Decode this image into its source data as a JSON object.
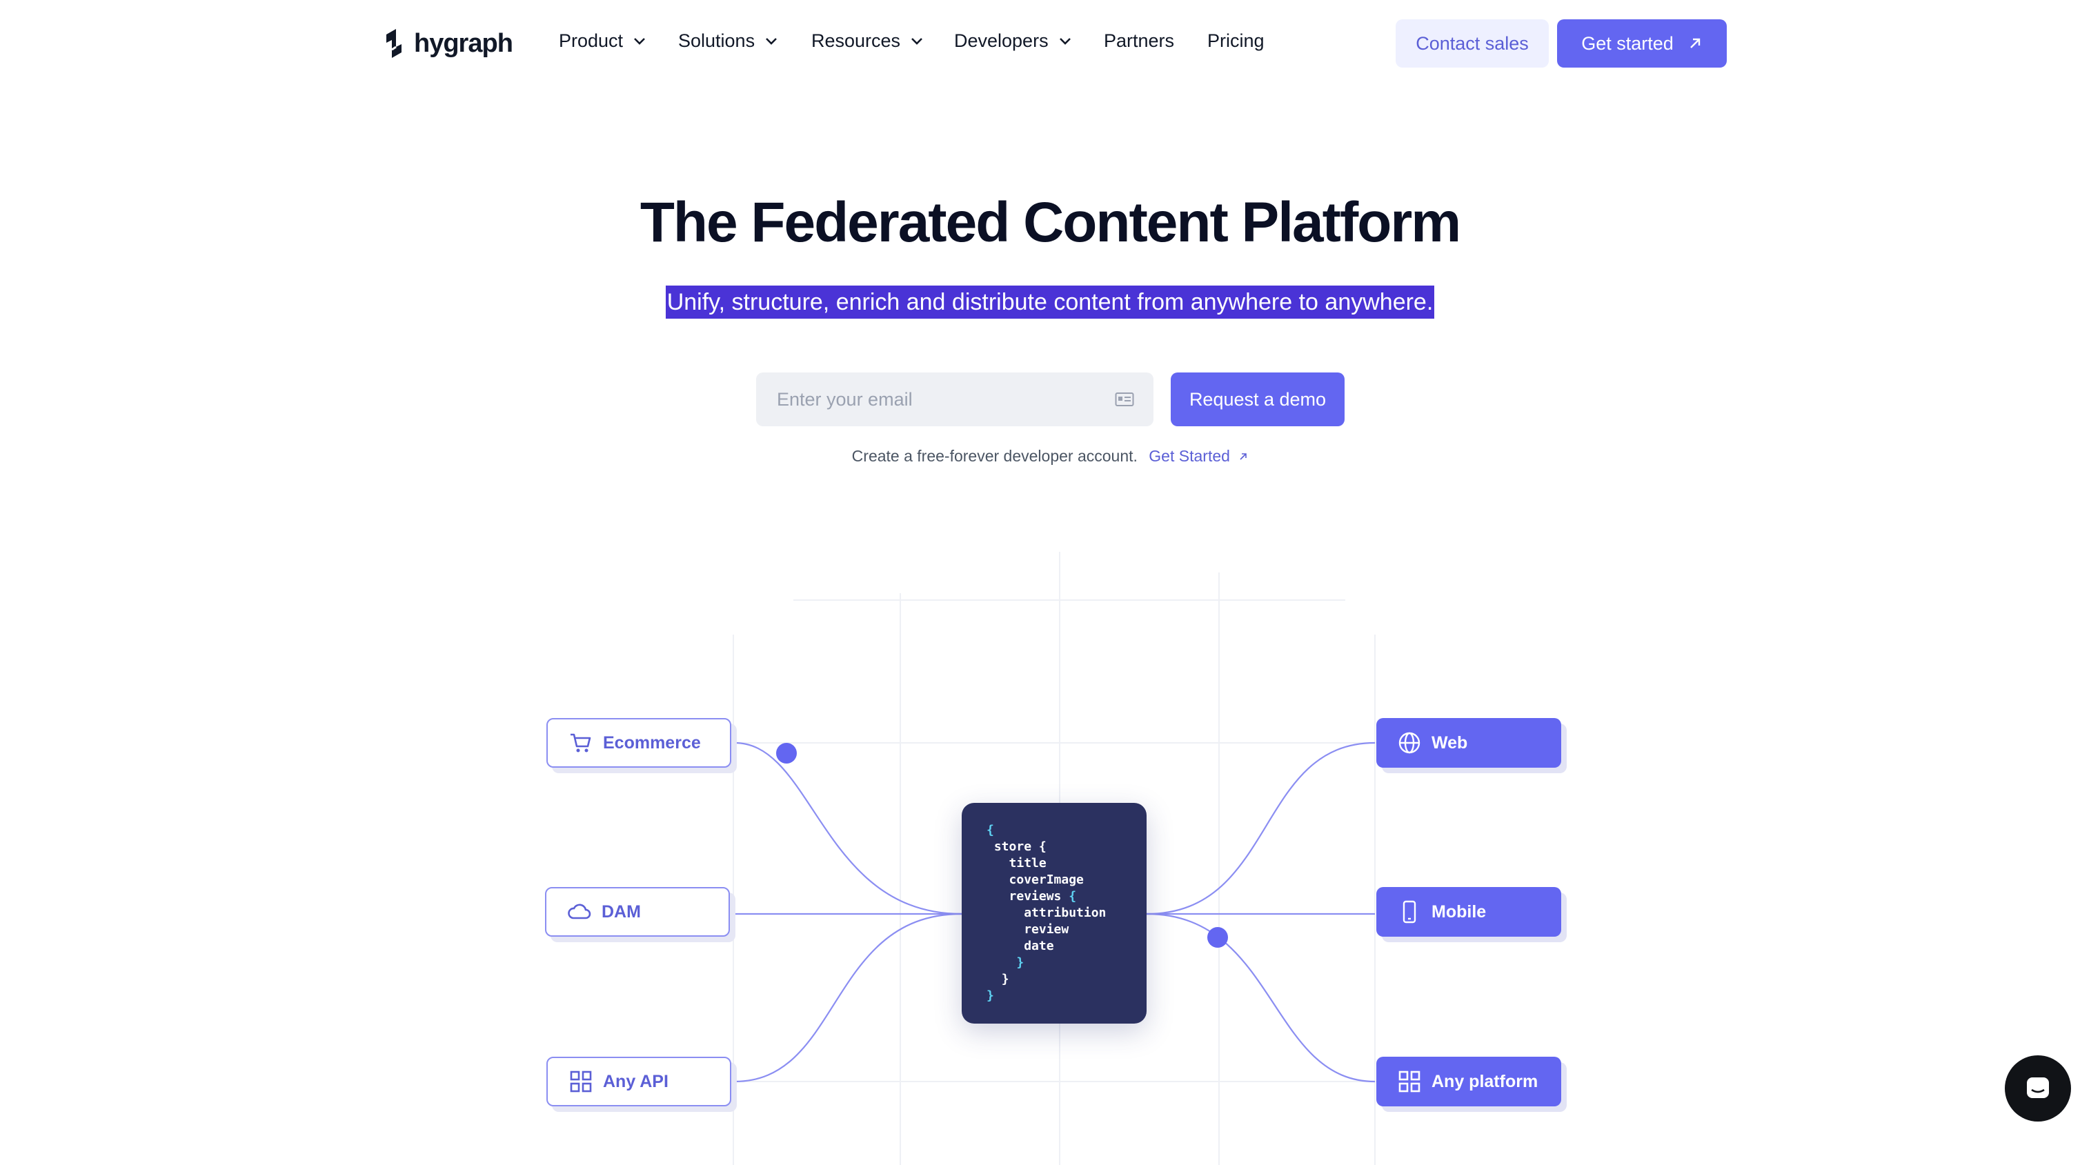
{
  "nav": {
    "logo_text": "hygraph",
    "items": [
      {
        "label": "Product"
      },
      {
        "label": "Solutions"
      },
      {
        "label": "Resources"
      },
      {
        "label": "Developers"
      },
      {
        "label": "Partners"
      },
      {
        "label": "Pricing"
      }
    ],
    "contact_label": "Contact sales",
    "get_started_label": "Get started"
  },
  "hero": {
    "title": "The Federated Content Platform",
    "subtitle": "Unify, structure, enrich and distribute content from anywhere to anywhere.",
    "email_placeholder": "Enter your email",
    "demo_label": "Request a demo",
    "note_text": "Create a free-forever developer account.",
    "note_link": "Get Started"
  },
  "diagram": {
    "sources": [
      {
        "label": "Ecommerce",
        "icon": "cart-icon"
      },
      {
        "label": "DAM",
        "icon": "cloud-icon"
      },
      {
        "label": "Any API",
        "icon": "grid-icon"
      }
    ],
    "destinations": [
      {
        "label": "Web",
        "icon": "globe-icon"
      },
      {
        "label": "Mobile",
        "icon": "mobile-icon"
      },
      {
        "label": "Any platform",
        "icon": "grid-icon"
      }
    ],
    "code": {
      "l1": "{",
      "l2_key": "store",
      "l2_brace": "{",
      "l3": "title",
      "l4": "coverImage",
      "l5_key": "reviews",
      "l5_brace": "{",
      "l6": "attribution",
      "l7": "review",
      "l8": "date",
      "l9": "}",
      "l10": "}",
      "l11": "}"
    }
  },
  "colors": {
    "accent": "#6366f1",
    "accent_light": "#eef0ff",
    "code_bg": "#2b3160",
    "selection": "#4a33d6",
    "code_brace": "#5fd3f3"
  }
}
